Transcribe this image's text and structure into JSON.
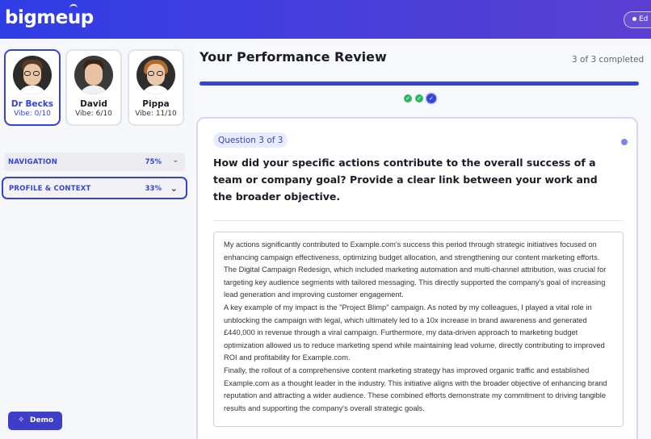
{
  "header": {
    "logo_text_start": "bigme",
    "logo_text_end": "up",
    "right_button_label": "Ed"
  },
  "team": [
    {
      "name": "Dr Becks",
      "vibe": "Vibe: 0/10",
      "active": true
    },
    {
      "name": "David",
      "vibe": "Vibe: 6/10",
      "active": false
    },
    {
      "name": "Pippa",
      "vibe": "Vibe: 11/10",
      "active": false
    }
  ],
  "sections": [
    {
      "label": "NAVIGATION",
      "percent": "75%",
      "chevron": "⌄",
      "open": false
    },
    {
      "label": "PROFILE & CONTEXT",
      "percent": "33%",
      "chevron": "⌄",
      "open": true
    }
  ],
  "demo_button": {
    "label": "Demo",
    "icon": "magic-wand-icon"
  },
  "review": {
    "title": "Your Performance Review",
    "completed": "3 of 3 completed",
    "progress": 1.0,
    "steps": [
      "done",
      "done",
      "current"
    ]
  },
  "question": {
    "badge": "Question 3 of 3",
    "text": "How did your specific actions contribute to the overall success of a team or company goal? Provide a clear link between your work and the broader objective.",
    "answer": [
      "My actions significantly contributed to Example.com's success this period through strategic initiatives focused on enhancing campaign effectiveness, optimizing budget allocation, and strengthening our content marketing efforts. The Digital Campaign Redesign, which included marketing automation and multi-channel attribution, was crucial for targeting key audience segments with tailored messaging. This directly supported the company's goal of increasing lead generation and improving customer engagement.",
      "A key example of my impact is the \"Project Blimp\" campaign. As noted by my colleagues, I played a vital role in unblocking the campaign with legal, which ultimately led to a 10x increase in brand awareness and generated £440,000 in revenue through a viral campaign. Furthermore, my data-driven approach to marketing budget optimization allowed us to reduce marketing spend while maintaining lead volume, directly contributing to improved ROI and profitability for Example.com.",
      "Finally, the rollout of a comprehensive content marketing strategy has improved organic traffic and established Example.com as a thought leader in the industry. This initiative aligns with the broader objective of enhancing brand reputation and attracting a wider audience. These combined efforts demonstrate my commitment to driving tangible results and supporting the company's overall strategic goals."
    ]
  },
  "colors": {
    "accent": "#3344d6",
    "success": "#2db760",
    "header_start": "#2f3de6",
    "header_end": "#5b3fd3"
  }
}
